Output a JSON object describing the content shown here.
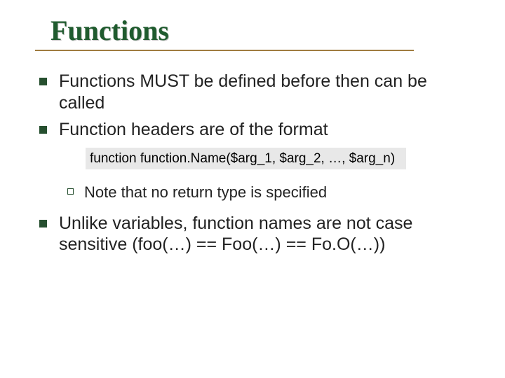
{
  "title": "Functions",
  "bullets": {
    "b1": "Functions MUST be defined before then can be called",
    "b2": "Function headers are of the format",
    "code": "function function.Name($arg_1, $arg_2, …, $arg_n)",
    "sub1": "Note that no return type is specified",
    "b3": "Unlike variables, function names are not case sensitive (foo(…) == Foo(…) == Fo.O(…))"
  }
}
